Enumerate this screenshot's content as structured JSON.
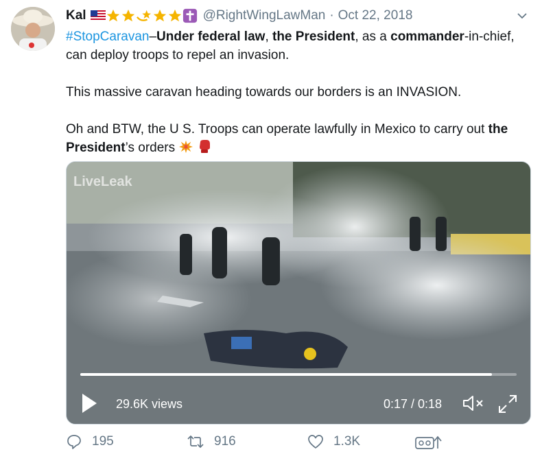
{
  "tweet": {
    "author_name": "Kal",
    "badges": [
      "us-flag-icon",
      "star-icon",
      "star-icon",
      "shooting-star-icon",
      "star-icon",
      "star-icon",
      "cross-icon"
    ],
    "handle": "@RightWingLawMan",
    "separator": "·",
    "date": "Oct 22, 2018",
    "hashtag": "#StopCaravan",
    "line1_dash": "–",
    "line1_bold1": "Under federal law",
    "line1_comma1": ", ",
    "line1_bold2": "the President",
    "line1_comma2": ", as a ",
    "line1_bold3": "commander",
    "line1_rest": "-in-chief, can deploy troops to repel an invasion.",
    "para2": "This massive caravan heading towards our borders is an INVASION.",
    "para3_text": "Oh and BTW, the U S. Troops can operate lawfully in Mexico to carry out",
    "para3_bold": "the President",
    "para3_end": "’s orders",
    "emoji": [
      "collision-icon",
      "boxing-glove-icon"
    ]
  },
  "video": {
    "watermark": "LiveLeak",
    "views": "29.6K views",
    "time": "0:17 / 0:18",
    "progress": 0.944,
    "controls": [
      "play-icon",
      "mute-icon",
      "fullscreen-icon"
    ]
  },
  "actions": {
    "reply_count": "195",
    "retweet_count": "916",
    "like_count": "1.3K"
  },
  "colors": {
    "link": "#1b95e0",
    "secondary_text": "#657786",
    "star": "#f5b400",
    "cross": "#9b59b6"
  }
}
